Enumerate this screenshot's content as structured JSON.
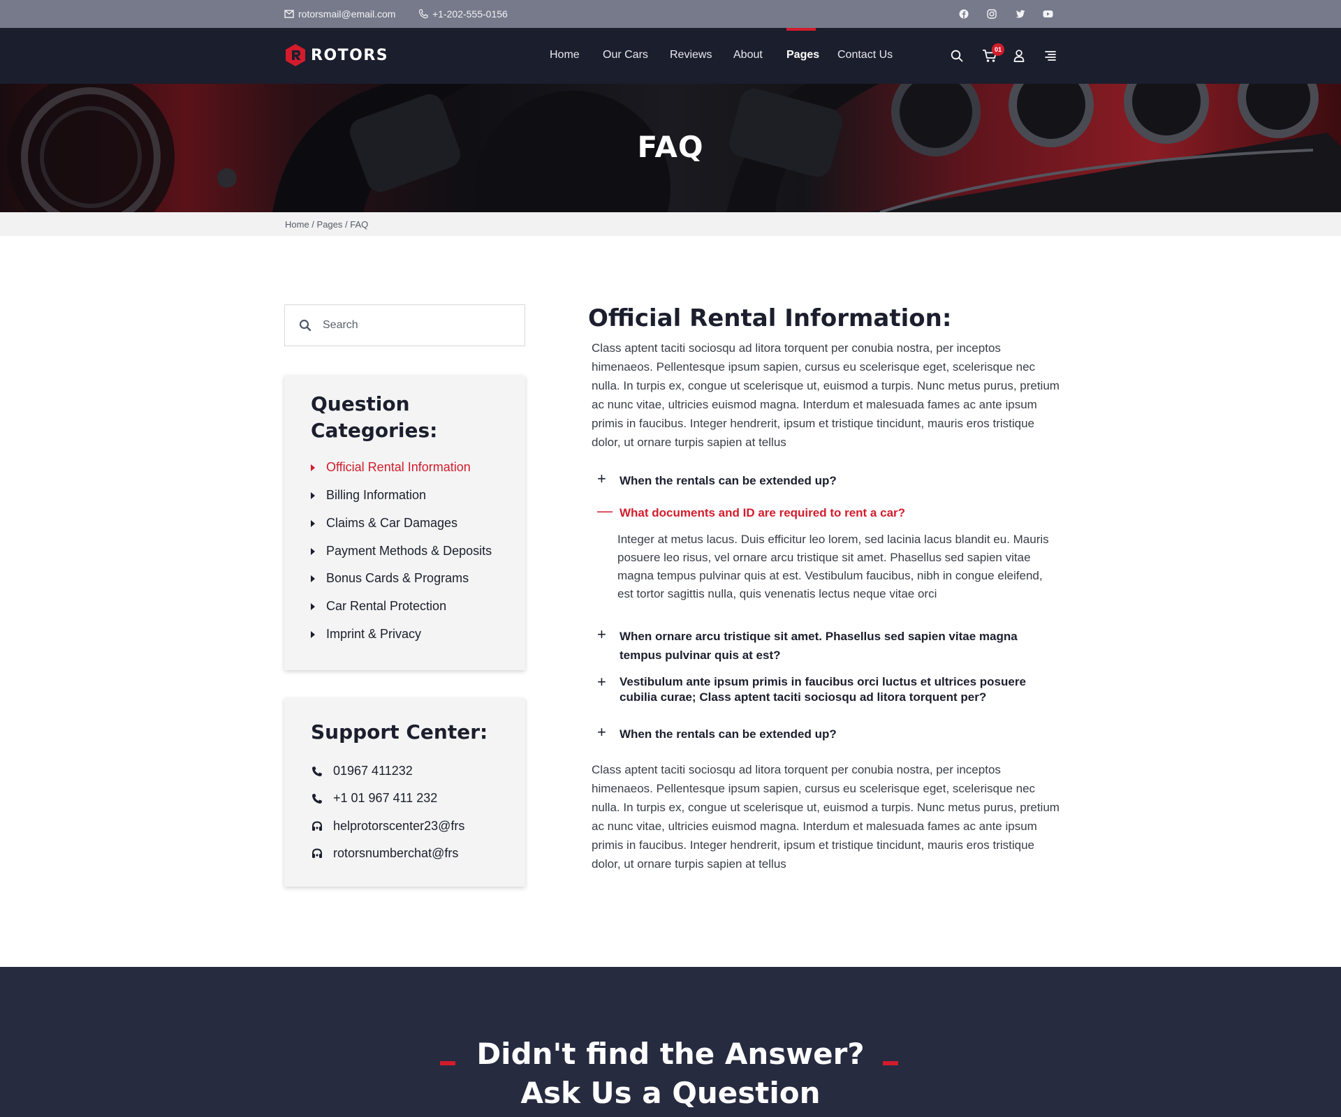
{
  "topbar": {
    "email": "rotorsmail@email.com",
    "phone": "+1-202-555-0156",
    "social": [
      "facebook-icon",
      "instagram-icon",
      "twitter-icon",
      "youtube-icon"
    ]
  },
  "brand": {
    "name": "ROTORS",
    "accent": "#d21c2c"
  },
  "nav": {
    "items": [
      "Home",
      "Our Cars",
      "Reviews",
      "About",
      "Pages",
      "Contact Us"
    ],
    "active": "Pages",
    "cart_count": "01"
  },
  "hero": {
    "title": "FAQ"
  },
  "breadcrumb": [
    "Home",
    "Pages",
    "FAQ"
  ],
  "sidebar": {
    "search_placeholder": "Search",
    "categories_title": [
      "Question",
      "Categories:"
    ],
    "categories": [
      "Official Rental Information",
      "Billing Information",
      "Claims & Car Damages",
      "Payment Methods & Deposits",
      "Bonus Cards & Programs",
      "Car Rental Protection",
      "Imprint & Privacy"
    ],
    "active_category": "Official Rental Information",
    "support_title": "Support Center:",
    "support": [
      {
        "icon": "phone-icon",
        "text": "01967 411232"
      },
      {
        "icon": "phone-icon",
        "text": "+1 01 967 411 232"
      },
      {
        "icon": "headset-icon",
        "text": "helprotorscenter23@frs"
      },
      {
        "icon": "headset-icon",
        "text": "rotorsnumberchat@frs"
      }
    ]
  },
  "main": {
    "title": "Official Rental Information:",
    "intro": "Class aptent taciti sociosqu ad litora torquent per conubia nostra, per inceptos himenaeos. Pellentesque ipsum sapien, cursus eu scelerisque eget, scelerisque nec nulla. In turpis ex, congue ut scelerisque ut, euismod a turpis. Nunc metus purus, pretium ac nunc vitae, ultricies euismod magna. Interdum et malesuada fames ac ante ipsum primis in faucibus. Integer hendrerit, ipsum et tristique tincidunt, mauris eros tristique dolor, ut ornare turpis sapien at tellus",
    "faqs": [
      {
        "q": "When the rentals can be extended up?",
        "open": false
      },
      {
        "q": "What documents and ID are required to rent a car?",
        "open": true,
        "a": "Integer at metus lacus. Duis efficitur leo lorem, sed lacinia lacus blandit eu. Mauris posuere leo risus, vel ornare arcu tristique sit amet. Phasellus sed sapien vitae magna tempus pulvinar quis at est. Vestibulum faucibus, nibh in congue eleifend, est tortor sagittis nulla, quis venenatis lectus neque vitae orci"
      },
      {
        "q": "When ornare arcu tristique sit amet. Phasellus sed sapien vitae magna tempus pulvinar quis at est?",
        "open": false
      },
      {
        "q": "Vestibulum ante ipsum primis in faucibus orci luctus et ultrices posuere cubilia curae; Class aptent taciti sociosqu ad litora torquent per?",
        "open": false
      },
      {
        "q": "When the rentals can be extended up?",
        "open": false
      }
    ],
    "outro": "Class aptent taciti sociosqu ad litora torquent per conubia nostra, per inceptos himenaeos. Pellentesque ipsum sapien, cursus eu scelerisque eget, scelerisque nec nulla. In turpis ex, congue ut scelerisque ut, euismod a turpis. Nunc metus purus, pretium ac nunc vitae, ultricies euismod magna. Interdum et malesuada fames ac ante ipsum primis in faucibus. Integer hendrerit, ipsum et tristique tincidunt, mauris eros tristique dolor, ut ornare turpis sapien at tellus"
  },
  "cta": {
    "line1": "Didn't find the Answer?",
    "line2": "Ask Us a Question"
  }
}
